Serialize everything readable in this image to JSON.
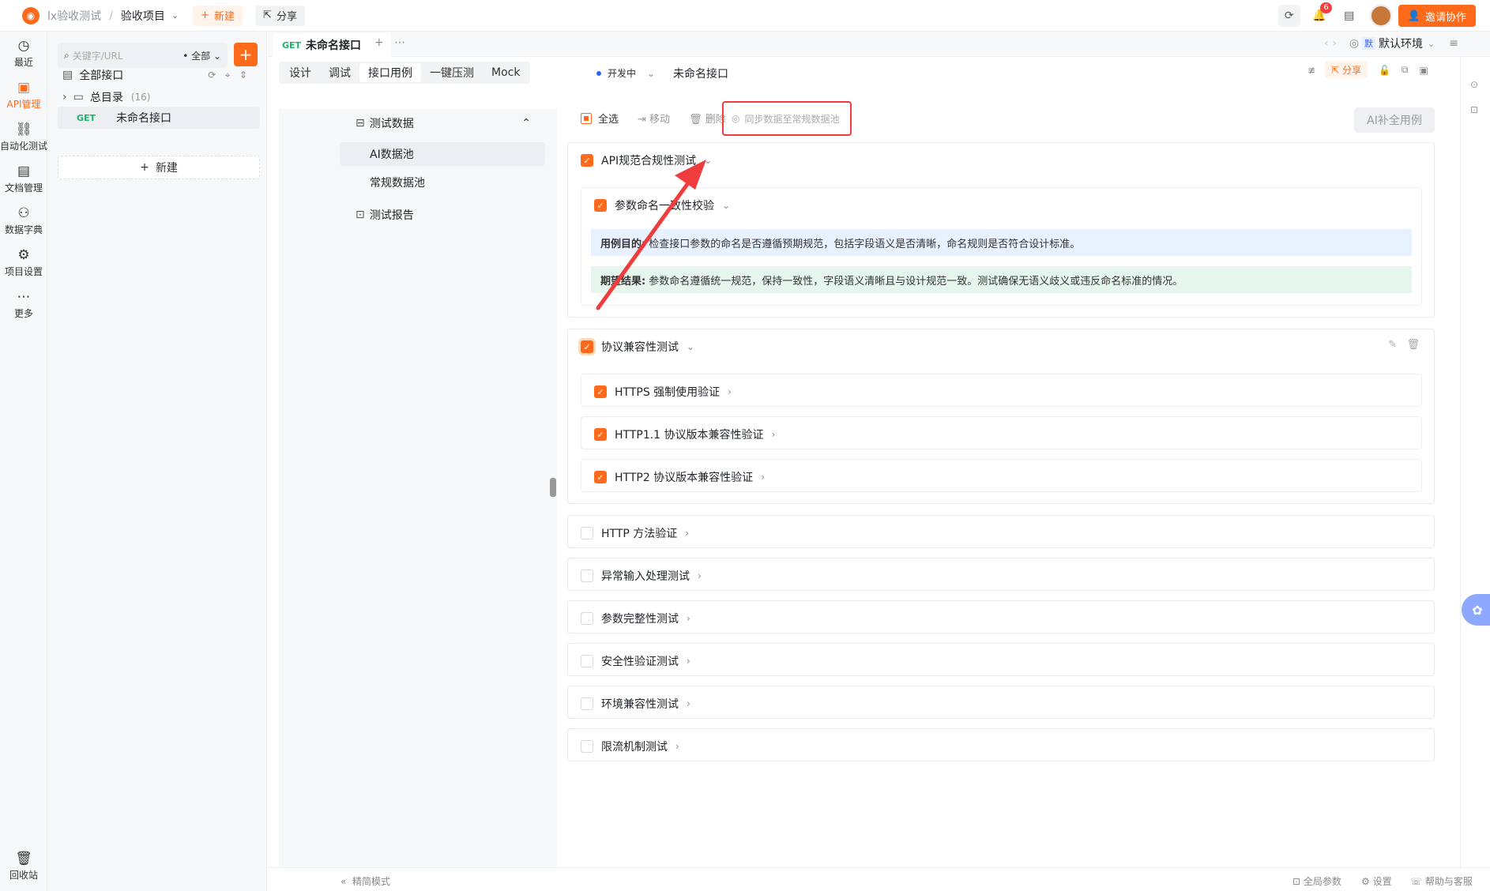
{
  "topbar": {
    "logo_glyph": "◉",
    "team": "lx验收测试",
    "project": "验收项目",
    "new_label": "新建",
    "share_label": "分享",
    "notification_count": "6",
    "invite_label": "邀请协作"
  },
  "nav": {
    "items": [
      {
        "label": "最近",
        "icon": "clock-icon"
      },
      {
        "label": "API管理",
        "icon": "api-icon"
      },
      {
        "label": "自动化测试",
        "icon": "automation-icon"
      },
      {
        "label": "文档管理",
        "icon": "document-icon"
      },
      {
        "label": "数据字典",
        "icon": "dictionary-icon"
      },
      {
        "label": "项目设置",
        "icon": "settings-icon"
      },
      {
        "label": "更多",
        "icon": "more-icon"
      }
    ],
    "recycle": "回收站"
  },
  "tree": {
    "search_placeholder": "关键字/URL",
    "filter": "全部",
    "all_apis": "全部接口",
    "root_folder": "总目录",
    "root_count": "(16)",
    "api_method": "GET",
    "api_name": "未命名接口",
    "new_label": "新建"
  },
  "tabs": {
    "active_method": "GET",
    "active_name": "未命名接口",
    "env_badge": "默",
    "env_label": "默认环境"
  },
  "subtabs": [
    "设计",
    "调试",
    "接口用例",
    "一键压测",
    "Mock"
  ],
  "api": {
    "status": "开发中",
    "title": "未命名接口",
    "share": "分享"
  },
  "leftpanel": {
    "test_data": "测试数据",
    "ai_pool": "AI数据池",
    "normal_pool": "常规数据池",
    "report": "测试报告"
  },
  "toolbar": {
    "select_all": "全选",
    "move": "移动",
    "delete": "删除",
    "sync": "同步数据至常规数据池",
    "ai_fill": "AI补全用例"
  },
  "groups": [
    {
      "name": "API规范合规性测试",
      "checked": true,
      "sub": {
        "name": "参数命名一致性校验",
        "purpose_label": "用例目的:",
        "purpose": "检查接口参数的命名是否遵循预期规范，包括字段语义是否清晰，命名规则是否符合设计标准。",
        "expected_label": "期望结果:",
        "expected": "参数命名遵循统一规范，保持一致性，字段语义清晰且与设计规范一致。测试确保无语义歧义或违反命名标准的情况。"
      }
    },
    {
      "name": "协议兼容性测试",
      "checked": true,
      "items": [
        "HTTPS 强制使用验证",
        "HTTP1.1 协议版本兼容性验证",
        "HTTP2 协议版本兼容性验证"
      ]
    }
  ],
  "collapsed_groups": [
    "HTTP 方法验证",
    "异常输入处理测试",
    "参数完整性测试",
    "安全性验证测试",
    "环境兼容性测试",
    "限流机制测试"
  ],
  "footer": {
    "compact": "精简模式",
    "global_params": "全局参数",
    "settings": "设置",
    "help": "帮助与客服"
  },
  "colors": {
    "accent": "#ff6a1a",
    "annotation": "#f03c3c",
    "get_method": "#1bb36a"
  }
}
